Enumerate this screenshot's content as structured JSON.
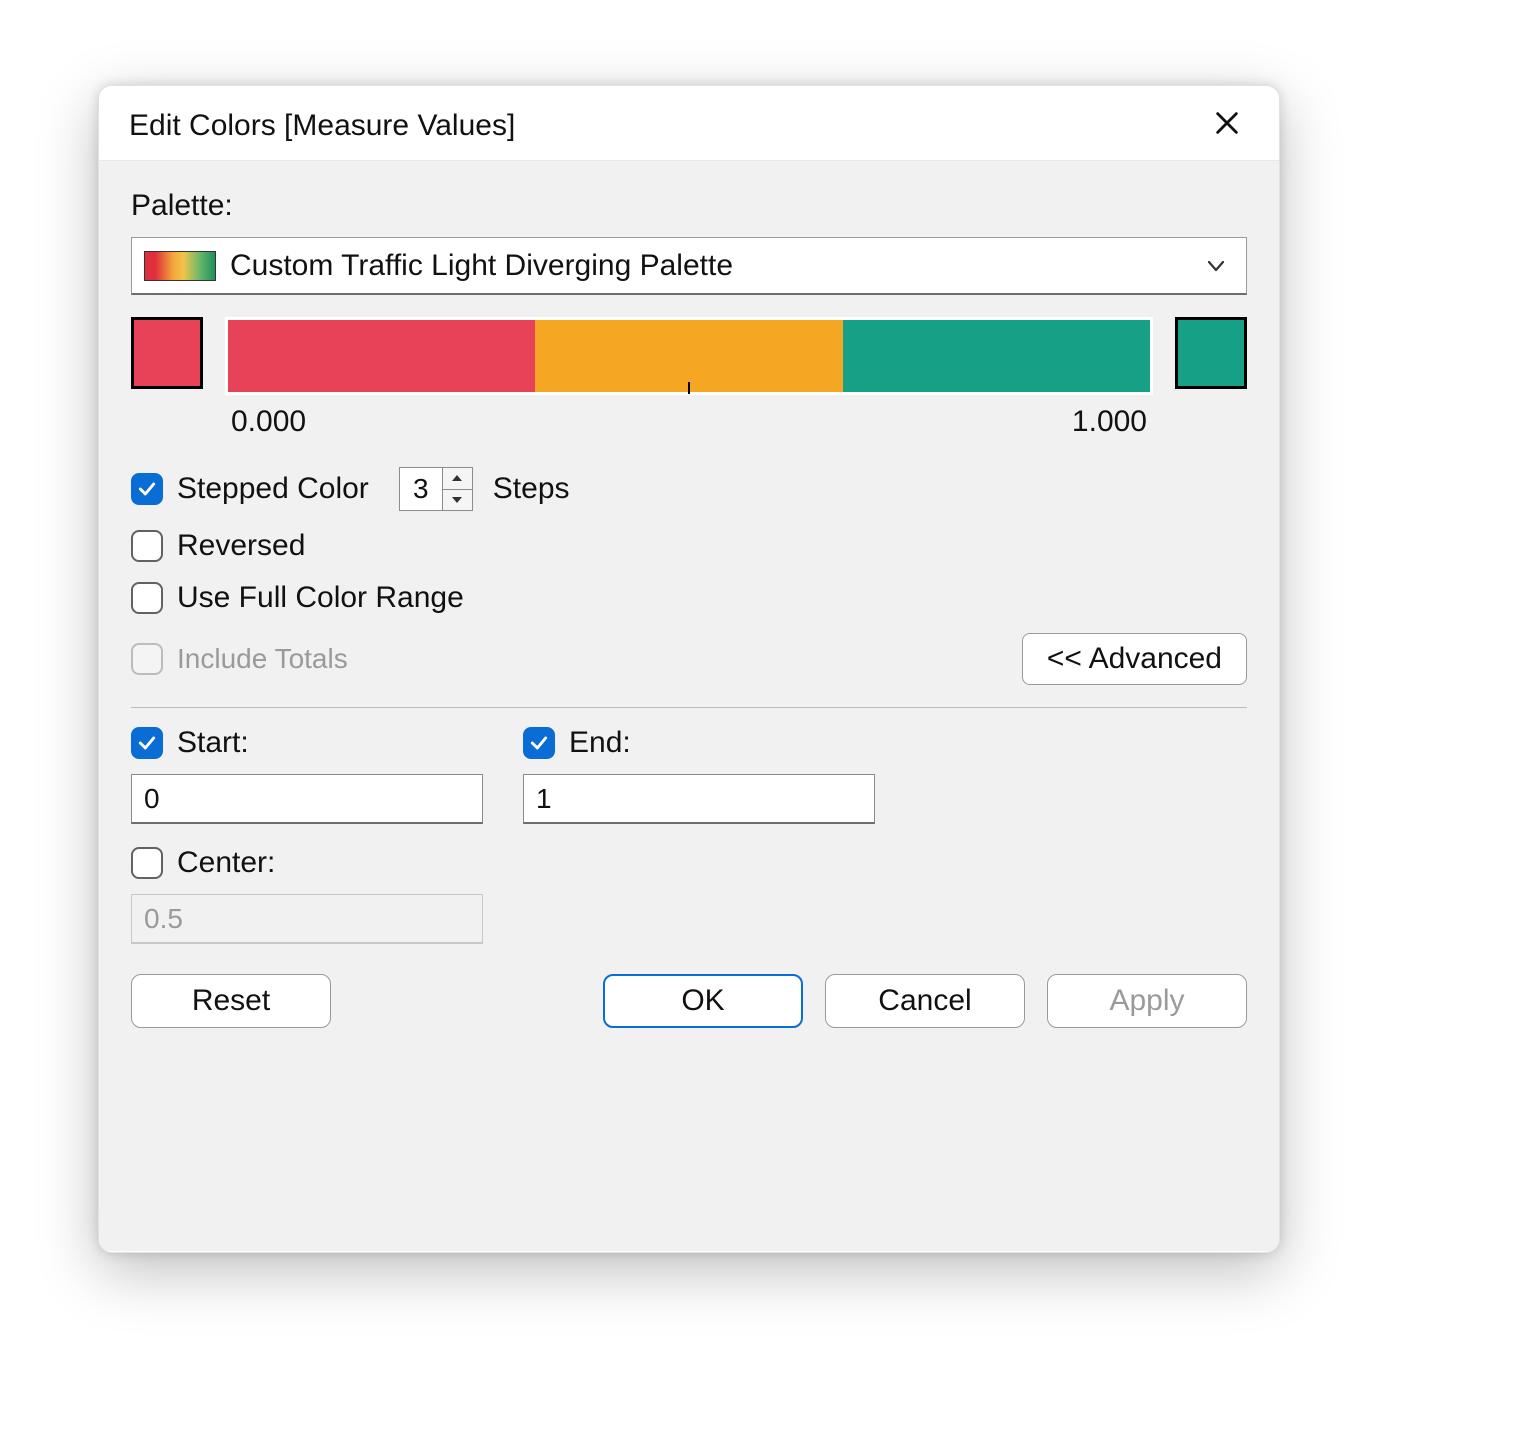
{
  "title": "Edit Colors [Measure Values]",
  "palette": {
    "label": "Palette:",
    "selected_name": "Custom Traffic Light Diverging Palette",
    "start_color": "#e84258",
    "end_color": "#16a085",
    "steps_colors": [
      "#e84258",
      "#f5a623",
      "#16a085"
    ],
    "range_min_label": "0.000",
    "range_max_label": "1.000"
  },
  "options": {
    "stepped_color": {
      "label": "Stepped Color",
      "checked": true,
      "steps_value": "3",
      "steps_suffix": "Steps"
    },
    "reversed": {
      "label": "Reversed",
      "checked": false
    },
    "use_full_range": {
      "label": "Use Full Color Range",
      "checked": false
    },
    "include_totals": {
      "label": "Include Totals",
      "checked": false,
      "disabled": true
    }
  },
  "advanced_button": "<< Advanced",
  "advanced": {
    "start": {
      "label": "Start:",
      "checked": true,
      "value": "0"
    },
    "end": {
      "label": "End:",
      "checked": true,
      "value": "1"
    },
    "center": {
      "label": "Center:",
      "checked": false,
      "value": "0.5",
      "disabled": true
    }
  },
  "buttons": {
    "reset": "Reset",
    "ok": "OK",
    "cancel": "Cancel",
    "apply": "Apply"
  }
}
